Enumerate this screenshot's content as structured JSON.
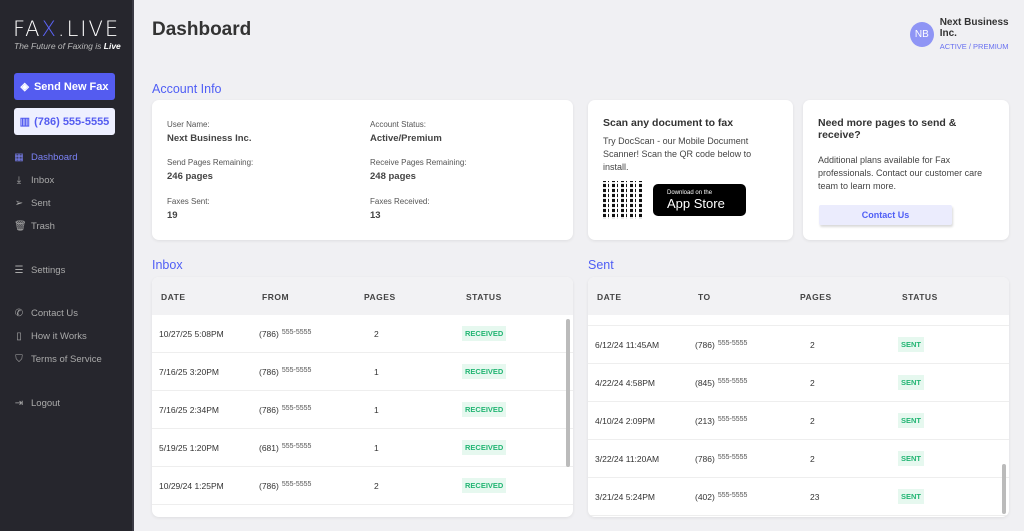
{
  "sidebar": {
    "logo_left": "FA",
    "logo_x": "X",
    "logo_right": ".LIVE",
    "tagline_pre": "The Future of Faxing is ",
    "tagline_bold": "Live",
    "send_button": "Send New Fax",
    "phone_button": "(786) 555-5555",
    "items": [
      {
        "label": "Dashboard",
        "icon": "grid-icon"
      },
      {
        "label": "Inbox",
        "icon": "inbox-icon"
      },
      {
        "label": "Sent",
        "icon": "send-icon"
      },
      {
        "label": "Trash",
        "icon": "trash-icon"
      },
      {
        "label": "Settings",
        "icon": "sliders-icon"
      },
      {
        "label": "Contact Us",
        "icon": "phone-icon"
      },
      {
        "label": "How it Works",
        "icon": "book-icon"
      },
      {
        "label": "Terms of Service",
        "icon": "shield-icon"
      },
      {
        "label": "Logout",
        "icon": "logout-icon"
      }
    ]
  },
  "header": {
    "title": "Dashboard",
    "avatar": "NB",
    "user_name": "Next Business Inc.",
    "user_status": "ACTIVE / PREMIUM"
  },
  "account": {
    "heading": "Account Info",
    "fields": [
      {
        "label": "User Name:",
        "value": "Next Business Inc."
      },
      {
        "label": "Account Status:",
        "value": "Active/Premium"
      },
      {
        "label": "Send Pages Remaining:",
        "value": "246 pages"
      },
      {
        "label": "Receive Pages Remaining:",
        "value": "248 pages"
      },
      {
        "label": "Faxes Sent:",
        "value": "19"
      },
      {
        "label": "Faxes Received:",
        "value": "13"
      }
    ]
  },
  "scan": {
    "title": "Scan any document to fax",
    "text": "Try DocScan - our Mobile Document Scanner! Scan the QR code below to install.",
    "store_small": "Download on the",
    "store_big": "App Store"
  },
  "more": {
    "title": "Need more pages to send & receive?",
    "text": "Additional plans available for Fax professionals. Contact our customer care team to learn more.",
    "button": "Contact Us"
  },
  "inbox": {
    "heading": "Inbox",
    "columns": [
      "DATE",
      "FROM",
      "PAGES",
      "STATUS"
    ],
    "rows": [
      {
        "date": "10/27/25 5:08PM",
        "area": "(786)",
        "num": "555-5555",
        "pages": "2",
        "status": "RECEIVED"
      },
      {
        "date": "7/16/25 3:20PM",
        "area": "(786)",
        "num": "555-5555",
        "pages": "1",
        "status": "RECEIVED"
      },
      {
        "date": "7/16/25 2:34PM",
        "area": "(786)",
        "num": "555-5555",
        "pages": "1",
        "status": "RECEIVED"
      },
      {
        "date": "5/19/25 1:20PM",
        "area": "(681)",
        "num": "555-5555",
        "pages": "1",
        "status": "RECEIVED"
      },
      {
        "date": "10/29/24 1:25PM",
        "area": "(786)",
        "num": "555-5555",
        "pages": "2",
        "status": "RECEIVED"
      }
    ]
  },
  "sent": {
    "heading": "Sent",
    "columns": [
      "DATE",
      "TO",
      "PAGES",
      "STATUS"
    ],
    "rows": [
      {
        "date": "6/12/24 11:45AM",
        "area": "(786)",
        "num": "555-5555",
        "pages": "2",
        "status": "SENT"
      },
      {
        "date": "4/22/24 4:58PM",
        "area": "(845)",
        "num": "555-5555",
        "pages": "2",
        "status": "SENT"
      },
      {
        "date": "4/10/24 2:09PM",
        "area": "(213)",
        "num": "555-5555",
        "pages": "2",
        "status": "SENT"
      },
      {
        "date": "3/22/24 11:20AM",
        "area": "(786)",
        "num": "555-5555",
        "pages": "2",
        "status": "SENT"
      },
      {
        "date": "3/21/24 5:24PM",
        "area": "(402)",
        "num": "555-5555",
        "pages": "23",
        "status": "SENT"
      }
    ]
  }
}
